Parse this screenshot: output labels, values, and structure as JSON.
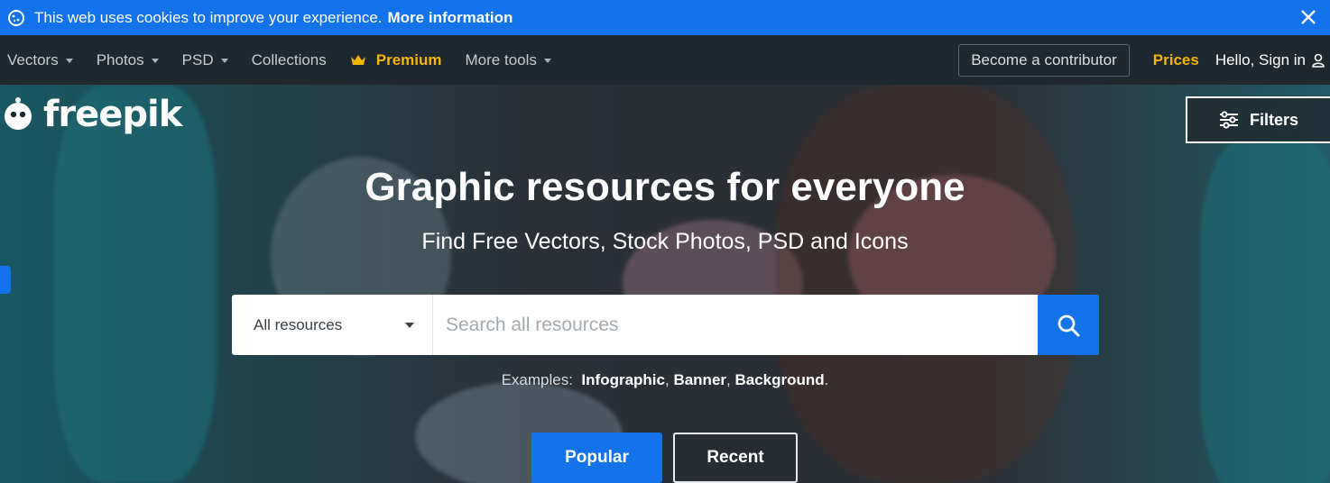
{
  "cookie_bar": {
    "message": "This web uses cookies to improve your experience.",
    "link": "More information"
  },
  "nav": {
    "items": [
      {
        "label": "Vectors",
        "dropdown": true
      },
      {
        "label": "Photos",
        "dropdown": true
      },
      {
        "label": "PSD",
        "dropdown": true
      },
      {
        "label": "Collections",
        "dropdown": false
      }
    ],
    "premium": "Premium",
    "more_tools": "More tools",
    "contributor": "Become a contributor",
    "prices": "Prices",
    "signin": "Hello, Sign in"
  },
  "logo": "freepik",
  "filters": "Filters",
  "hero": {
    "title": "Graphic resources for everyone",
    "subtitle": "Find Free Vectors, Stock Photos, PSD and Icons"
  },
  "search": {
    "type_selected": "All resources",
    "placeholder": "Search all resources"
  },
  "examples": {
    "label": "Examples:",
    "items": [
      "Infographic",
      "Banner",
      "Background"
    ]
  },
  "tabs": {
    "popular": "Popular",
    "recent": "Recent"
  },
  "colors": {
    "brand_blue": "#1273eb",
    "premium_gold": "#f6b600",
    "nav_bg": "#1f282e"
  }
}
